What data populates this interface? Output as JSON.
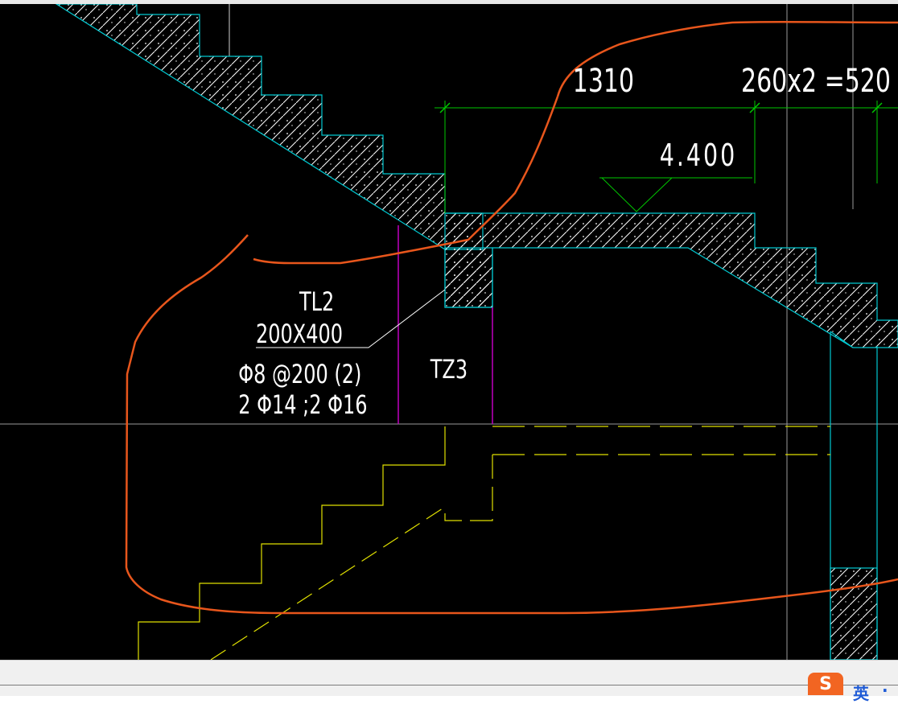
{
  "drawing": {
    "dimensions": {
      "left": "1310",
      "right": "260x2 =520"
    },
    "elevation": "4.400",
    "beam_label": {
      "name": "TL2",
      "size": "200X400",
      "stirrups": "Φ8 @200 (2)",
      "longitudinal": "2 Φ14 ;2 Φ16"
    },
    "column_label": "TZ3"
  },
  "colors": {
    "background": "#000000",
    "outline": "#00c8d0",
    "dimension": "#00c800",
    "markup": "#e8561c",
    "column": "#c000c0",
    "hidden": "#e0e000",
    "text": "#ffffff"
  },
  "ime": {
    "logo": "S",
    "mode": "英",
    "separator": "·"
  }
}
